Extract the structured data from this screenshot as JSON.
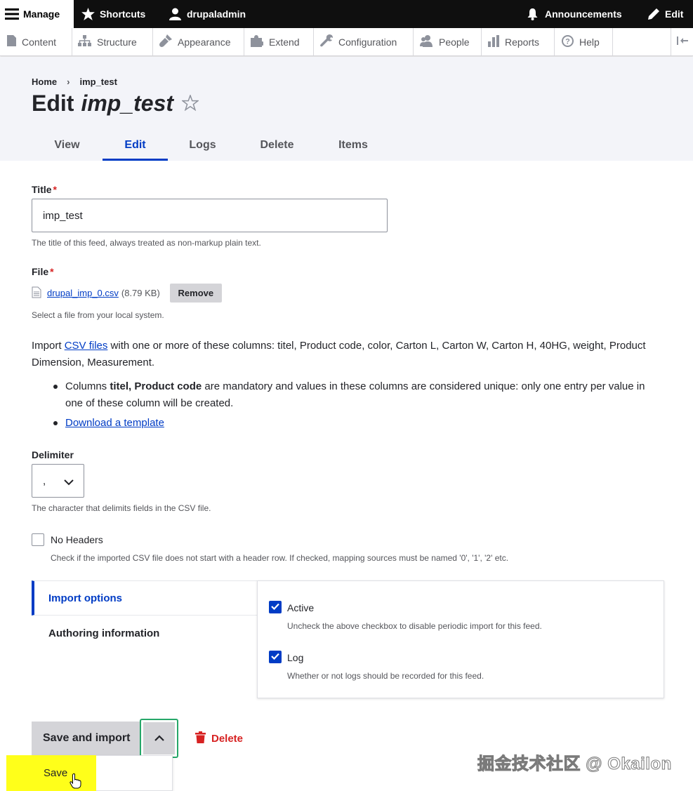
{
  "toolbar": {
    "manage": "Manage",
    "shortcuts": "Shortcuts",
    "user": "drupaladmin",
    "announcements": "Announcements",
    "edit": "Edit"
  },
  "tray": {
    "items": [
      "Content",
      "Structure",
      "Appearance",
      "Extend",
      "Configuration",
      "People",
      "Reports",
      "Help"
    ]
  },
  "breadcrumb": {
    "home": "Home",
    "current": "imp_test"
  },
  "page": {
    "title_prefix": "Edit",
    "title_name": "imp_test"
  },
  "tabs": [
    "View",
    "Edit",
    "Logs",
    "Delete",
    "Items"
  ],
  "form": {
    "title_label": "Title",
    "title_value": "imp_test",
    "title_desc": "The title of this feed, always treated as non-markup plain text.",
    "file_label": "File",
    "file_name": "drupal_imp_0.csv",
    "file_size": "(8.79 KB)",
    "remove_label": "Remove",
    "file_desc": "Select a file from your local system.",
    "import_prefix": "Import ",
    "import_link": "CSV files",
    "import_rest": " with one or more of these columns: titel, Product code, color, Carton L, Carton W, Carton H, 40HG, weight, Product Dimension, Measurement.",
    "bullet1_prefix": "Columns ",
    "bullet1_bold": "titel, Product code",
    "bullet1_rest": " are mandatory and values in these columns are considered unique: only one entry per value in one of these column will be created.",
    "bullet2_link": "Download a template",
    "delimiter_label": "Delimiter",
    "delimiter_value": ",",
    "delimiter_desc": "The character that delimits fields in the CSV file.",
    "noheaders_label": "No Headers",
    "noheaders_desc": "Check if the imported CSV file does not start with a header row. If checked, mapping sources must be named '0', '1', '2' etc."
  },
  "vertical_tabs": {
    "import_options": "Import options",
    "authoring": "Authoring information",
    "active_label": "Active",
    "active_desc": "Uncheck the above checkbox to disable periodic import for this feed.",
    "log_label": "Log",
    "log_desc": "Whether or not logs should be recorded for this feed."
  },
  "actions": {
    "save_and_import": "Save and import",
    "delete": "Delete",
    "save": "Save"
  },
  "watermark": "掘金技术社区 @ Okailon",
  "colors": {
    "primary": "#003cc5",
    "danger": "#d72222",
    "focus": "#26a769",
    "highlight": "#ffff1a"
  }
}
